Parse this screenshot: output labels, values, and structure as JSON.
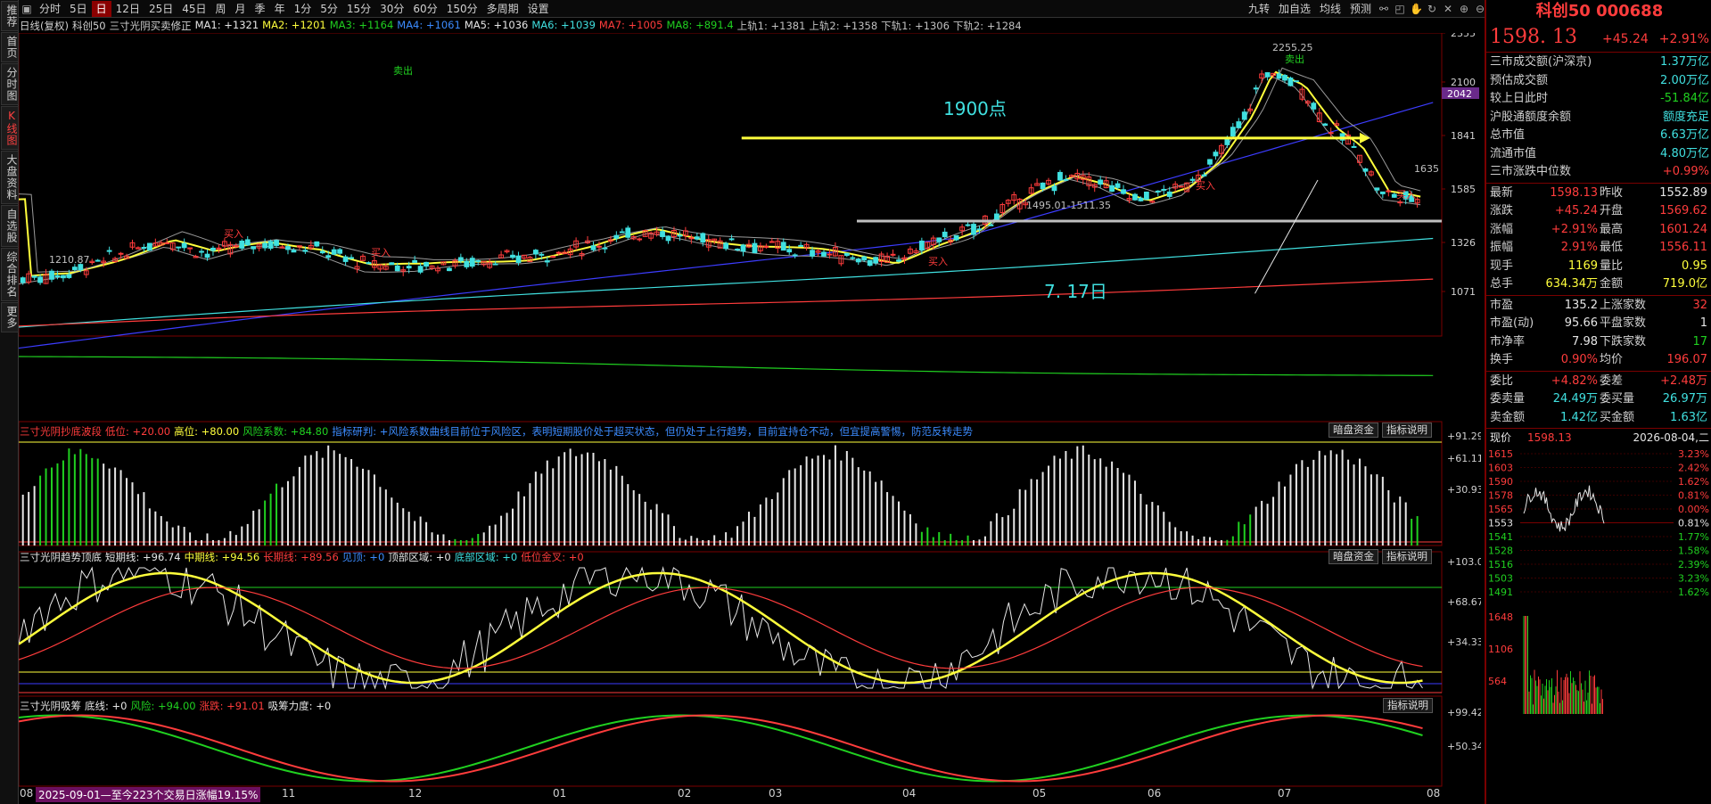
{
  "nav": {
    "items": [
      "推荐",
      "首页",
      "分时图",
      "K线图",
      "大盘资料",
      "自选股",
      "综合排名",
      "更多"
    ],
    "active_index": 3
  },
  "toolbar": {
    "left_items": [
      "分时",
      "5日",
      "日",
      "12日",
      "25日",
      "45日",
      "周",
      "月",
      "季",
      "年",
      "1分",
      "5分",
      "15分",
      "30分",
      "60分",
      "150分",
      "多周期",
      "设置"
    ],
    "active_item": "日",
    "right_items": [
      "九转",
      "加自选",
      "均线",
      "预测"
    ]
  },
  "ma_line": {
    "prefix": "日线(复权)",
    "stock": "科创50",
    "indicator": "三寸光阴买卖修正",
    "items": [
      {
        "label": "MA1: +1321",
        "color": "#e6e6e6"
      },
      {
        "label": "MA2: +1201",
        "color": "#ffff3c"
      },
      {
        "label": "MA3: +1164",
        "color": "#20d020"
      },
      {
        "label": "MA4: +1061",
        "color": "#3c8cff"
      },
      {
        "label": "MA5: +1036",
        "color": "#e6e6e6"
      },
      {
        "label": "MA6: +1039",
        "color": "#40e0e0"
      },
      {
        "label": "MA7: +1005",
        "color": "#ff3c3c"
      },
      {
        "label": "MA8: +891.4",
        "color": "#20d020"
      },
      {
        "label": "上轨1: +1381",
        "color": "#c0c0c0"
      },
      {
        "label": "上轨2: +1358",
        "color": "#c0c0c0"
      },
      {
        "label": "下轨1: +1306",
        "color": "#c0c0c0"
      },
      {
        "label": "下轨2: +1284",
        "color": "#c0c0c0"
      }
    ]
  },
  "main_chart": {
    "y_ticks": [
      "2355",
      "2100",
      "1841",
      "1585",
      "1326",
      "1071"
    ],
    "price_tag": "2042",
    "annotation_1900": "1900点",
    "annotation_717": "7. 17日",
    "range_label": "1495.01-1511.35",
    "high_label": "2255.25",
    "low_label": "1210.87",
    "cur_label": "1635",
    "buy_label": "买入",
    "sell_label": "卖出"
  },
  "sub1": {
    "name": "三寸光阴抄底波段",
    "params": [
      {
        "label": "低位: +20.00",
        "color": "#ff3c3c"
      },
      {
        "label": "高位: +80.00",
        "color": "#ffff3c"
      },
      {
        "label": "风险系数: +84.80",
        "color": "#20d020"
      },
      {
        "label": "指标研判: +风险系数曲线目前位于风险区，表明短期股价处于超买状态，但仍处于上行趋势，目前宜持仓不动，但宜提高警惕，防范反转走势",
        "color": "#3c8cff"
      }
    ],
    "buttons": [
      "暗盘资金",
      "指标说明"
    ],
    "y_ticks": [
      "+91.29",
      "+61.11",
      "+30.93"
    ]
  },
  "sub2": {
    "name": "三寸光阴趋势顶底",
    "params": [
      {
        "label": "短期线: +96.74",
        "color": "#e6e6e6"
      },
      {
        "label": "中期线: +94.56",
        "color": "#ffff3c"
      },
      {
        "label": "长期线: +89.56",
        "color": "#ff3c3c"
      },
      {
        "label": "见顶: +0",
        "color": "#3c8cff"
      },
      {
        "label": "顶部区域: +0",
        "color": "#e6e6e6"
      },
      {
        "label": "底部区域: +0",
        "color": "#40e0e0"
      },
      {
        "label": "低位金叉: +0",
        "color": "#ff3c3c"
      }
    ],
    "buttons": [
      "暗盘资金",
      "指标说明"
    ],
    "y_ticks": [
      "+103.0",
      "+68.67",
      "+34.33"
    ]
  },
  "sub3": {
    "name": "三寸光阴吸筹",
    "params": [
      {
        "label": "底线: +0",
        "color": "#e6e6e6"
      },
      {
        "label": "风险: +94.00",
        "color": "#20d020"
      },
      {
        "label": "涨跌: +91.01",
        "color": "#ff3c3c"
      },
      {
        "label": "吸筹力度: +0",
        "color": "#e6e6e6"
      }
    ],
    "buttons": [
      "指标说明"
    ],
    "y_ticks": [
      "+99.42",
      "+50.34"
    ]
  },
  "dates": [
    "08",
    "2025-09-01—至今223个交易日涨幅19.15%",
    "11",
    "12",
    "01",
    "02",
    "03",
    "04",
    "05",
    "06",
    "07",
    "08"
  ],
  "right_panel": {
    "title": "科创50 000688",
    "price": "1598. 13",
    "change": "+45.24",
    "change_pct": "+2.91%",
    "market_rows": [
      {
        "label": "三市成交额(沪深京)",
        "value": "1.37万亿",
        "color": "cyan"
      },
      {
        "label": "预估成交额",
        "value": "2.00万亿",
        "color": "cyan"
      },
      {
        "label": "较上日此时",
        "value": "-51.84亿",
        "color": "grn"
      },
      {
        "label": "沪股通额度余额",
        "value": "额度充足",
        "color": "cyan"
      },
      {
        "label": "总市值",
        "value": "6.63万亿",
        "color": "cyan"
      },
      {
        "label": "流通市值",
        "value": "4.80万亿",
        "color": "cyan"
      },
      {
        "label": "三市涨跌中位数",
        "value": "+0.99%",
        "color": "red"
      }
    ],
    "quote_pairs": [
      [
        {
          "label": "最新",
          "value": "1598.13",
          "color": "red"
        },
        {
          "label": "昨收",
          "value": "1552.89",
          "color": "wht"
        }
      ],
      [
        {
          "label": "涨跌",
          "value": "+45.24",
          "color": "red"
        },
        {
          "label": "开盘",
          "value": "1569.62",
          "color": "red"
        }
      ],
      [
        {
          "label": "涨幅",
          "value": "+2.91%",
          "color": "red"
        },
        {
          "label": "最高",
          "value": "1601.24",
          "color": "red"
        }
      ],
      [
        {
          "label": "振幅",
          "value": "2.91%",
          "color": "red"
        },
        {
          "label": "最低",
          "value": "1556.11",
          "color": "red"
        }
      ],
      [
        {
          "label": "现手",
          "value": "1169",
          "color": "yel"
        },
        {
          "label": "量比",
          "value": "0.95",
          "color": "yel"
        }
      ],
      [
        {
          "label": "总手",
          "value": "634.34万",
          "color": "yel"
        },
        {
          "label": "金额",
          "value": "719.0亿",
          "color": "yel"
        }
      ]
    ],
    "stat_pairs": [
      [
        {
          "label": "市盈",
          "value": "135.2",
          "color": "wht"
        },
        {
          "label": "上涨家数",
          "value": "32",
          "color": "red"
        }
      ],
      [
        {
          "label": "市盈(动)",
          "value": "95.66",
          "color": "wht"
        },
        {
          "label": "平盘家数",
          "value": "1",
          "color": "wht"
        }
      ],
      [
        {
          "label": "市净率",
          "value": "7.98",
          "color": "wht"
        },
        {
          "label": "下跌家数",
          "value": "17",
          "color": "grn"
        }
      ],
      [
        {
          "label": "换手",
          "value": "0.90%",
          "color": "red"
        },
        {
          "label": "均价",
          "value": "196.07",
          "color": "red"
        }
      ]
    ],
    "order_pairs": [
      [
        {
          "label": "委比",
          "value": "+4.82%",
          "color": "red"
        },
        {
          "label": "委差",
          "value": "+2.48万",
          "color": "red"
        }
      ],
      [
        {
          "label": "委卖量",
          "value": "24.49万",
          "color": "cyan"
        },
        {
          "label": "委买量",
          "value": "26.97万",
          "color": "cyan"
        }
      ],
      [
        {
          "label": "卖金额",
          "value": "1.42亿",
          "color": "cyan"
        },
        {
          "label": "买金额",
          "value": "1.63亿",
          "color": "cyan"
        }
      ]
    ],
    "mini_header": {
      "label": "现价",
      "price": "1598.13",
      "date": "2026-08-04,二"
    },
    "mini_left": [
      "1615",
      "1603",
      "1590",
      "1578",
      "1565",
      "1553",
      "1541",
      "1528",
      "1516",
      "1503",
      "1491"
    ],
    "mini_right": [
      "3.23%",
      "2.42%",
      "1.62%",
      "0.81%",
      "0.00%",
      "0.81%",
      "1.77%",
      "1.58%",
      "2.39%",
      "3.23%",
      "1.62%"
    ],
    "vol_ticks": [
      "1648",
      "1106",
      "564"
    ]
  }
}
